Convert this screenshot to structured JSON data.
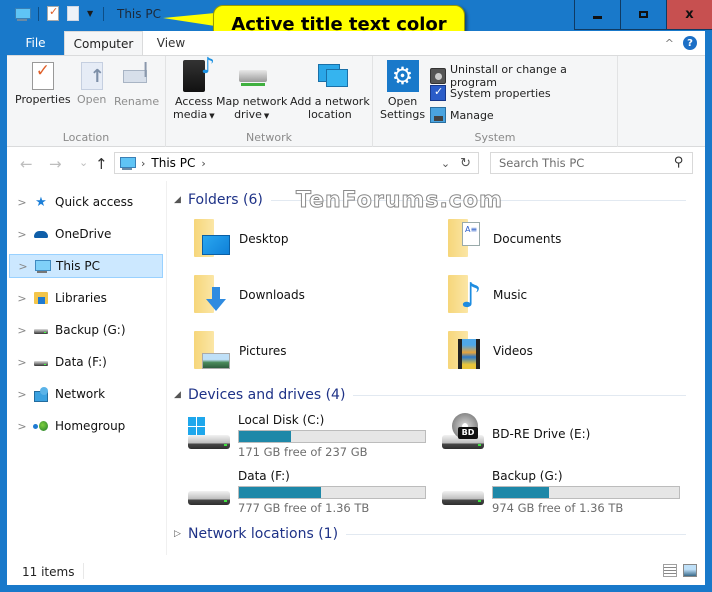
{
  "window": {
    "title": "This PC",
    "controls": {
      "minimize": "minimize",
      "maximize": "maximize",
      "close": "x"
    }
  },
  "callout": {
    "text": "Active title text color"
  },
  "colors": {
    "accent": "#1979ca",
    "close_button": "#c75050",
    "callout_bg": "#ffff00",
    "drive_bar_fill": "#1e88a8",
    "section_header": "#1e3287"
  },
  "quick_access_toolbar": {
    "icons": [
      "this-pc-icon",
      "properties-icon",
      "new-folder-icon",
      "customize-dropdown-icon"
    ]
  },
  "ribbon": {
    "tabs": [
      {
        "label": "File"
      },
      {
        "label": "Computer",
        "active": true
      },
      {
        "label": "View"
      }
    ],
    "collapse_glyph": "^",
    "help_glyph": "?",
    "groups": [
      {
        "label": "Location",
        "buttons": [
          {
            "label": "Properties",
            "icon": "properties-icon",
            "enabled": true
          },
          {
            "label": "Open",
            "icon": "open-icon",
            "enabled": false
          },
          {
            "label": "Rename",
            "icon": "rename-icon",
            "enabled": false
          }
        ]
      },
      {
        "label": "Network",
        "buttons": [
          {
            "line1": "Access",
            "line2": "media",
            "icon": "access-media-icon",
            "dropdown": true
          },
          {
            "line1": "Map network",
            "line2": "drive",
            "icon": "map-network-drive-icon",
            "dropdown": true
          },
          {
            "line1": "Add a network",
            "line2": "location",
            "icon": "add-network-location-icon"
          }
        ]
      },
      {
        "label": "System",
        "buttons": [
          {
            "line1": "Open",
            "line2": "Settings",
            "icon": "settings-gear-icon"
          },
          {
            "label": "Uninstall or change a program",
            "icon": "uninstall-icon"
          },
          {
            "label": "System properties",
            "icon": "system-properties-icon"
          },
          {
            "label": "Manage",
            "icon": "manage-icon"
          }
        ]
      }
    ]
  },
  "navigation": {
    "back_glyph": "←",
    "forward_glyph": "→",
    "recent_glyph": "⌄",
    "up_glyph": "↑",
    "breadcrumb": [
      {
        "label": "This PC"
      }
    ],
    "chevron": "›",
    "history_dropdown_glyph": "⌄",
    "refresh_glyph": "↻",
    "search_placeholder": "Search This PC",
    "search_value": ""
  },
  "sidebar": {
    "expand_glyph": ">",
    "items": [
      {
        "label": "Quick access",
        "icon": "quick-access-star-icon"
      },
      {
        "label": "OneDrive",
        "icon": "onedrive-cloud-icon"
      },
      {
        "label": "This PC",
        "icon": "this-pc-icon",
        "selected": true
      },
      {
        "label": "Libraries",
        "icon": "libraries-icon"
      },
      {
        "label": "Backup (G:)",
        "icon": "drive-icon"
      },
      {
        "label": "Data (F:)",
        "icon": "drive-icon"
      },
      {
        "label": "Network",
        "icon": "network-icon"
      },
      {
        "label": "Homegroup",
        "icon": "homegroup-icon"
      }
    ]
  },
  "main": {
    "watermark": "TenForums.com",
    "sections": {
      "folders": {
        "header": "Folders (6)",
        "expanded": true,
        "items": [
          {
            "label": "Desktop",
            "icon": "desktop-folder-icon"
          },
          {
            "label": "Documents",
            "icon": "documents-folder-icon"
          },
          {
            "label": "Downloads",
            "icon": "downloads-folder-icon"
          },
          {
            "label": "Music",
            "icon": "music-folder-icon"
          },
          {
            "label": "Pictures",
            "icon": "pictures-folder-icon"
          },
          {
            "label": "Videos",
            "icon": "videos-folder-icon"
          }
        ]
      },
      "devices": {
        "header": "Devices and drives (4)",
        "expanded": true,
        "items": [
          {
            "label": "Local Disk (C:)",
            "free_text": "171 GB free of 237 GB",
            "used_fraction": 0.28,
            "icon": "windows-drive-icon"
          },
          {
            "label": "BD-RE Drive (E:)",
            "icon": "bd-drive-icon",
            "bd_badge": "BD"
          },
          {
            "label": "Data (F:)",
            "free_text": "777 GB free of 1.36 TB",
            "used_fraction": 0.44,
            "icon": "hard-drive-icon"
          },
          {
            "label": "Backup (G:)",
            "free_text": "974 GB free of 1.36 TB",
            "used_fraction": 0.3,
            "icon": "hard-drive-icon"
          }
        ]
      },
      "network": {
        "header": "Network locations (1)",
        "expanded": false
      }
    },
    "expanded_glyph": "◢",
    "collapsed_glyph": "▷"
  },
  "statusbar": {
    "item_count": "11 items",
    "views": [
      "details-view",
      "large-icons-view"
    ]
  }
}
